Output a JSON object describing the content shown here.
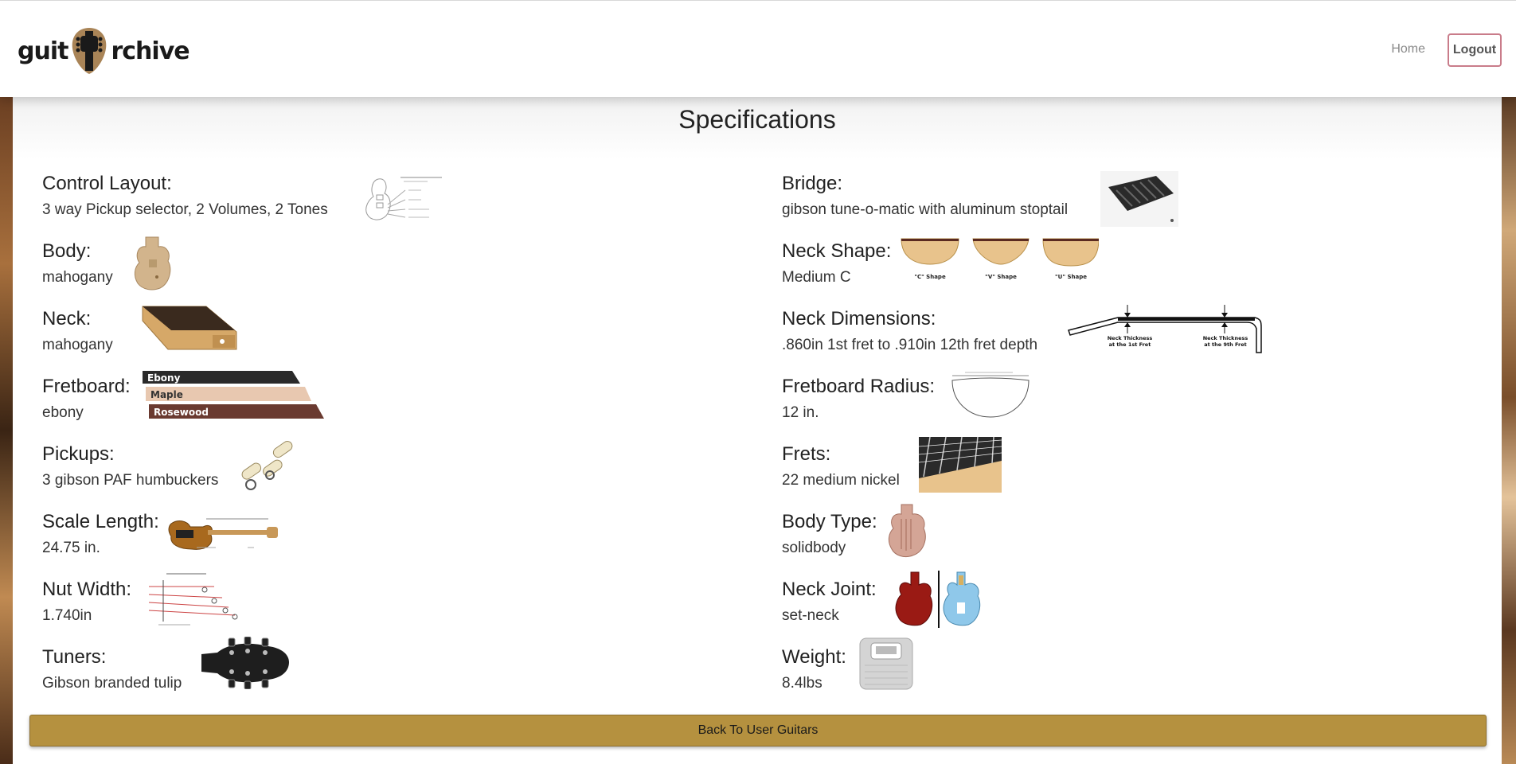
{
  "nav": {
    "logo_left": "guit",
    "logo_right": "rchive",
    "home": "Home",
    "logout": "Logout"
  },
  "page": {
    "title": "Specifications",
    "back_button": "Back To User Guitars"
  },
  "specs_left": [
    {
      "label": "Control Layout:",
      "value": "3 way Pickup selector, 2 Volumes, 2 Tones"
    },
    {
      "label": "Body:",
      "value": "mahogany"
    },
    {
      "label": "Neck:",
      "value": "mahogany"
    },
    {
      "label": "Fretboard:",
      "value": "ebony"
    },
    {
      "label": "Pickups:",
      "value": "3 gibson PAF humbuckers"
    },
    {
      "label": "Scale Length:",
      "value": "24.75 in."
    },
    {
      "label": "Nut Width:",
      "value": "1.740in"
    },
    {
      "label": "Tuners:",
      "value": "Gibson branded tulip"
    }
  ],
  "specs_right": [
    {
      "label": "Bridge:",
      "value": "gibson tune-o-matic with aluminum stoptail"
    },
    {
      "label": "Neck Shape:",
      "value": "Medium C"
    },
    {
      "label": "Neck Dimensions:",
      "value": ".860in 1st fret to .910in 12th fret depth"
    },
    {
      "label": "Fretboard Radius:",
      "value": "12 in."
    },
    {
      "label": "Frets:",
      "value": "22 medium nickel"
    },
    {
      "label": "Body Type:",
      "value": "solidbody"
    },
    {
      "label": "Neck Joint:",
      "value": "set-neck"
    },
    {
      "label": "Weight:",
      "value": "8.4lbs"
    }
  ],
  "image_text": {
    "fretboard_woods": [
      "Ebony",
      "Maple",
      "Rosewood"
    ],
    "neck_shapes": [
      "\"C\" Shape",
      "\"V\" Shape",
      "\"U\" Shape"
    ],
    "neck_thickness": [
      "Neck Thickness at the 1st Fret",
      "Neck Thickness at the 9th Fret"
    ]
  },
  "colors": {
    "accent_gold": "#b5913f",
    "logout_border": "#c97c8a"
  }
}
